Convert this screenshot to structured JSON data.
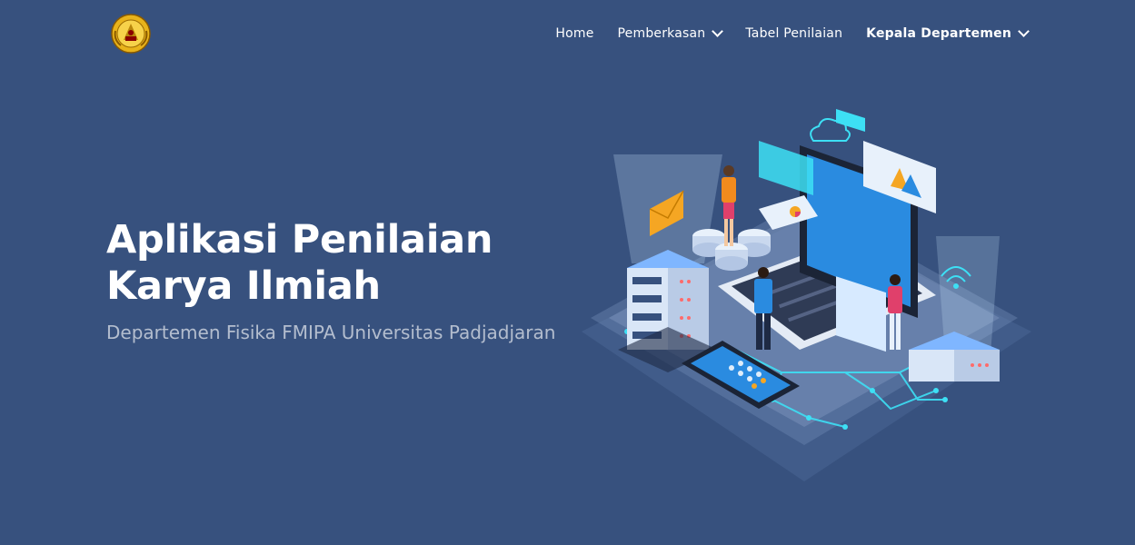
{
  "header": {
    "logo_icon": "university-crest-icon",
    "nav": [
      {
        "label": "Home",
        "dropdown": false,
        "active": false
      },
      {
        "label": "Pemberkasan",
        "dropdown": true,
        "active": false
      },
      {
        "label": "Tabel Penilaian",
        "dropdown": false,
        "active": false
      },
      {
        "label": "Kepala Departemen",
        "dropdown": true,
        "active": true
      }
    ]
  },
  "hero": {
    "title_line1": "Aplikasi Penilaian",
    "title_line2": "Karya Ilmiah",
    "subtitle": "Departemen Fisika FMIPA Universitas Padjadjaran",
    "illustration_icon": "isometric-technology-illustration"
  },
  "colors": {
    "background": "#37517e",
    "text": "#ffffff",
    "accent_cyan": "#3de0f5",
    "accent_orange": "#f5a623"
  }
}
